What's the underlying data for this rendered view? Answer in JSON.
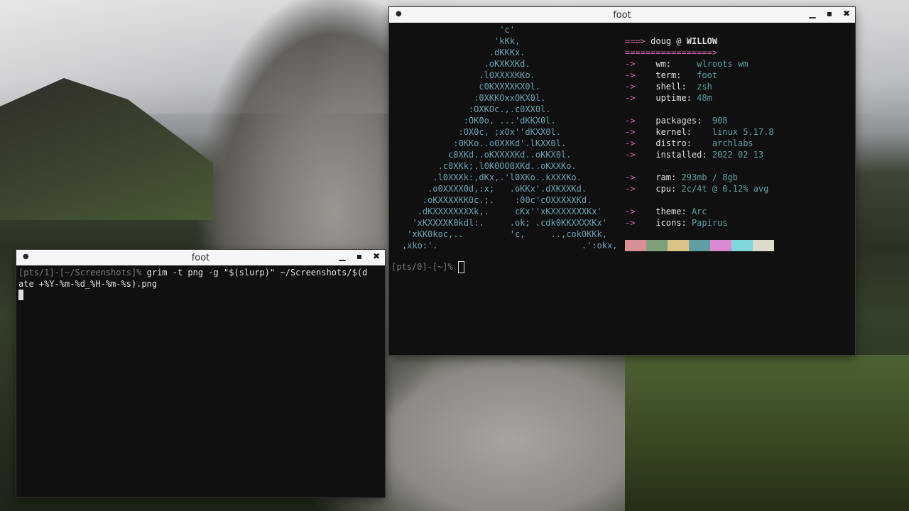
{
  "colors": {
    "terminal_bg": "#101010",
    "titlebar_bg": "#f5f6f7",
    "accent_pink": "#d46ab0",
    "logo_cyan": "#6aa2b4"
  },
  "window_left": {
    "title": "foot",
    "menu_icon": "bullet-icon",
    "controls": [
      "minimize-icon",
      "maximize-icon",
      "close-icon"
    ],
    "prompt_prefix": "[pts/1]-[~/Screenshots]%",
    "command_line1": " grim -t png -g \"$(slurp)\" ~/Screenshots/$(d",
    "command_line2": "ate +%Y-%m-%d_%H-%m-%s).png"
  },
  "window_right": {
    "title": "foot",
    "logo": [
      "                   'c'",
      "                  'kKk,",
      "                 .dKKKx.",
      "                .oKXKXKd.",
      "               .l0XXXXKKo.",
      "               c0KXXXXKX0l.",
      "              :0XKKOxxOKX0l.",
      "             :OXKOc.,.c0XX0l.",
      "            :OK0o, ...'dKKX0l.",
      "           :OX0c, ;xOx''dKXX0l.",
      "          :0KKo..o0XXKd'.lKXX0l.",
      "         c0XKd..oKXXXXKd..oKKX0l.",
      "       .c0XKk;.l0K0OO0XKd..oKXXKo.",
      "      .l0XXXk:,dKx,.'l0XKo..kXXXKo.",
      "     .o0XXXX0d,:x;   .oKKx'.dXKXXKd.",
      "    .oKXXXXKK0c.;.    :00c'cOXXXXXKd.",
      "   .dKXXXXXXXXk,.     cKx''xKXXXXXXXKx'",
      "  'xKXXXXK0kdl:.     .ok; .cdk0KKXXXXKx'",
      " 'xKK0koc,..         'c,     ..,cok0KKk,",
      ",xko:'.                            .':okx,"
    ],
    "user_header": {
      "arrow": "===>",
      "user": "doug",
      "at": "@",
      "host": "WILLOW",
      "underline": "=================>"
    },
    "info": [
      {
        "arrow": "->",
        "key": "wm:",
        "pad": "     ",
        "value": "wlroots wm"
      },
      {
        "arrow": "->",
        "key": "term:",
        "pad": "   ",
        "value": "foot"
      },
      {
        "arrow": "->",
        "key": "shell:",
        "pad": "  ",
        "value": "zsh"
      },
      {
        "arrow": "->",
        "key": "uptime:",
        "pad": " ",
        "value": "48m"
      },
      {
        "arrow": "->",
        "key": "packages:",
        "pad": "  ",
        "value": "908"
      },
      {
        "arrow": "->",
        "key": "kernel:",
        "pad": "    ",
        "value": "linux 5.17.8"
      },
      {
        "arrow": "->",
        "key": "distro:",
        "pad": "    ",
        "value": "archlabs"
      },
      {
        "arrow": "->",
        "key": "installed:",
        "pad": " ",
        "value": "2022 02 13"
      },
      {
        "arrow": "->",
        "key": "ram:",
        "pad": " ",
        "value": "293mb / 8gb"
      },
      {
        "arrow": "->",
        "key": "cpu:",
        "pad": " ",
        "value": "2c/4t @ 0.12% avg"
      },
      {
        "arrow": "->",
        "key": "theme:",
        "pad": " ",
        "value": "Arc"
      },
      {
        "arrow": "->",
        "key": "icons:",
        "pad": " ",
        "value": "Papirus"
      }
    ],
    "palette": [
      "#d88f95",
      "#7ea07a",
      "#d9c485",
      "#5f9ea3",
      "#d98ad0",
      "#7fd6dc",
      "#dddccb"
    ],
    "prompt_prefix": "[pts/0]-[~]%"
  }
}
